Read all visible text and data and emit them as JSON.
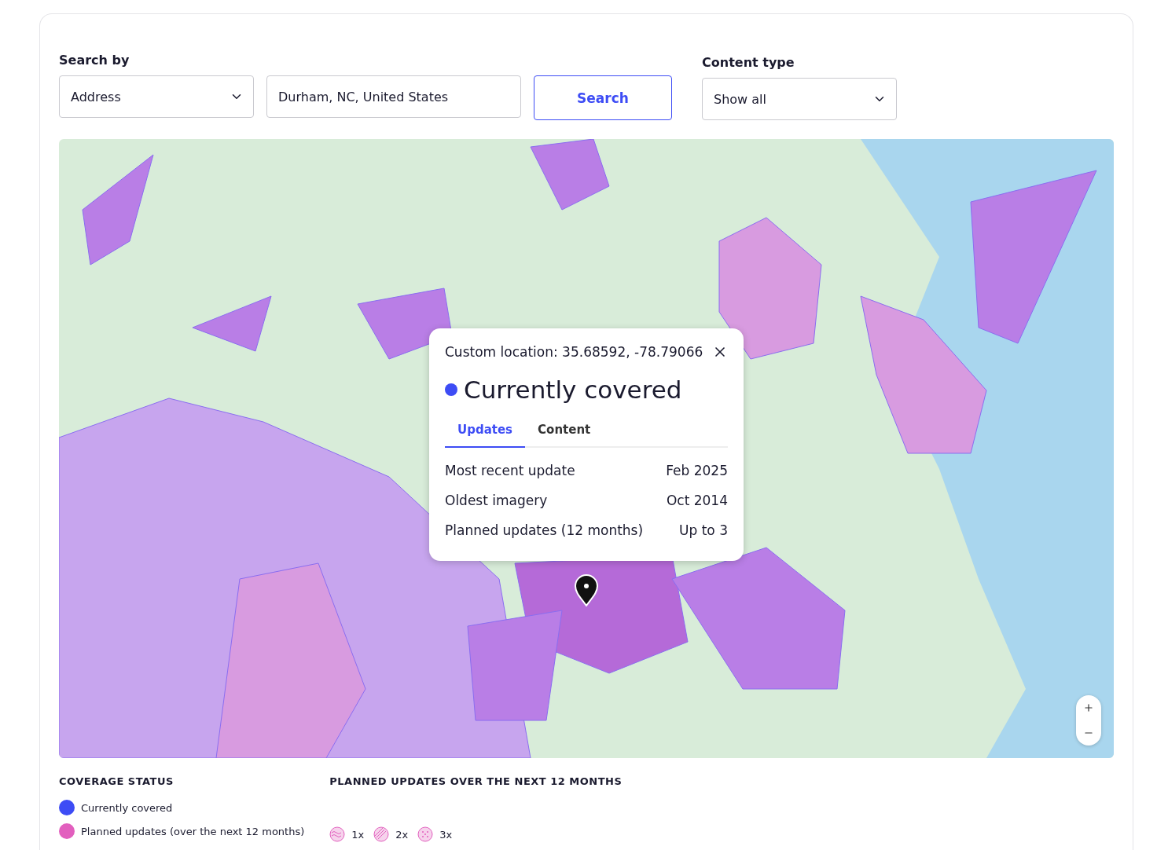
{
  "search_by": {
    "label": "Search by",
    "select": "Address",
    "input": "Durham, NC, United States",
    "button": "Search"
  },
  "content_type": {
    "label": "Content type",
    "select": "Show all"
  },
  "popup": {
    "title": "Custom location: 35.68592, -78.79066",
    "status": {
      "label": "Currently covered",
      "color": "#3d4cf5"
    },
    "tabs": [
      {
        "label": "Updates",
        "selected": true
      },
      {
        "label": "Content",
        "selected": false
      }
    ],
    "rows": [
      {
        "label": "Most recent update",
        "value": "Feb 2025"
      },
      {
        "label": "Oldest imagery",
        "value": "Oct 2014"
      },
      {
        "label": "Planned updates (12 months)",
        "value": "Up to 3"
      }
    ]
  },
  "legend": {
    "coverage": {
      "title": "COVERAGE STATUS",
      "items": [
        {
          "label": "Currently covered",
          "color": "#3d4cf5"
        },
        {
          "label": "Planned updates (over the next 12 months)",
          "color": "#e25fbe"
        }
      ]
    },
    "planned": {
      "title": "PLANNED UPDATES OVER THE NEXT 12 MONTHS",
      "items": [
        {
          "kind": "wave",
          "label": "1x"
        },
        {
          "kind": "hatch",
          "label": "2x"
        },
        {
          "kind": "dots",
          "label": "3x"
        }
      ]
    }
  }
}
